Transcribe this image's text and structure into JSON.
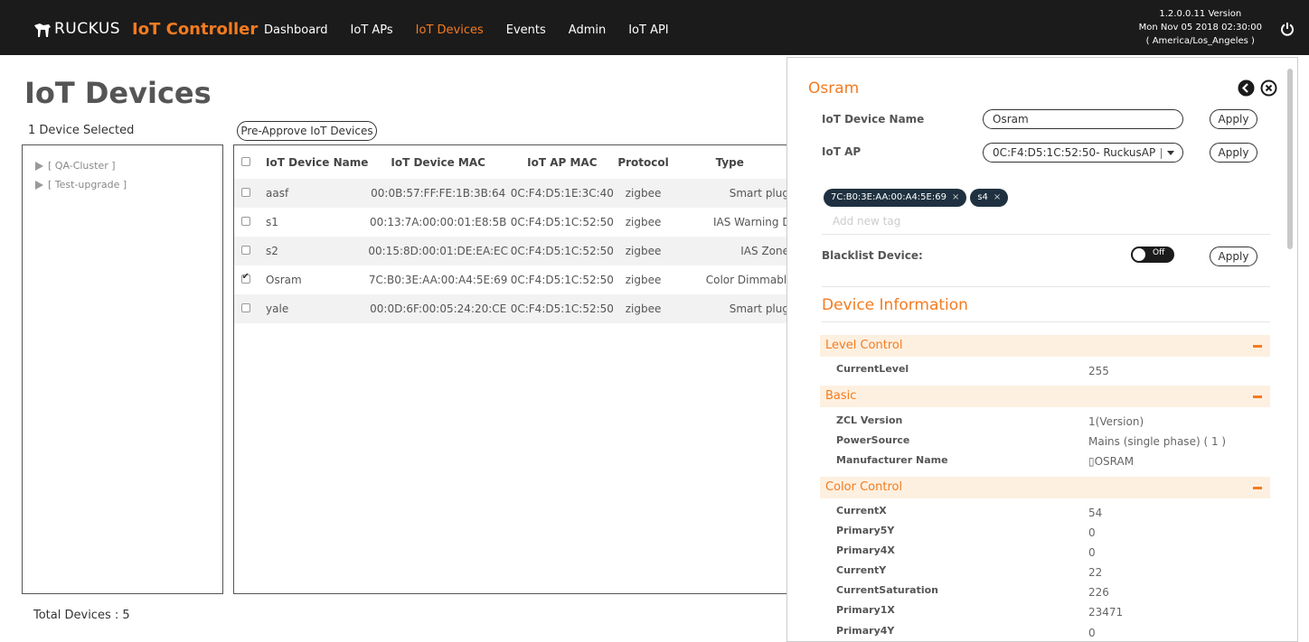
{
  "header": {
    "logo_text": "RUCKUS",
    "product": "IoT Controller",
    "nav": [
      "Dashboard",
      "IoT APs",
      "IoT Devices",
      "Events",
      "Admin",
      "IoT API"
    ],
    "version": "1.2.0.0.11 Version",
    "datetime": "Mon Nov 05 2018 02:30:00",
    "timezone": "( America/Los_Angeles )"
  },
  "page": {
    "title": "IoT Devices",
    "selected": "1 Device Selected",
    "preapprove": "Pre-Approve IoT Devices",
    "total": "Total Devices : 5"
  },
  "tree": [
    "[ QA-Cluster ]",
    "[ Test-upgrade ]"
  ],
  "table": {
    "headers": [
      "IoT Device Name",
      "IoT Device MAC",
      "IoT AP MAC",
      "Protocol",
      "Type"
    ],
    "rows": [
      {
        "name": "aasf",
        "mac": "00:0B:57:FF:FE:1B:3B:64",
        "apmac": "0C:F4:D5:1E:3C:40",
        "protocol": "zigbee",
        "type": "Smart plug"
      },
      {
        "name": "s1",
        "mac": "00:13:7A:00:00:01:E8:5B",
        "apmac": "0C:F4:D5:1C:52:50",
        "protocol": "zigbee",
        "type": "IAS Warning Devic"
      },
      {
        "name": "s2",
        "mac": "00:15:8D:00:01:DE:EA:EC",
        "apmac": "0C:F4:D5:1C:52:50",
        "protocol": "zigbee",
        "type": "IAS Zone"
      },
      {
        "name": "Osram",
        "mac": "7C:B0:3E:AA:00:A4:5E:69",
        "apmac": "0C:F4:D5:1C:52:50",
        "protocol": "zigbee",
        "type": "Color Dimmable Lig"
      },
      {
        "name": "yale",
        "mac": "00:0D:6F:00:05:24:20:CE",
        "apmac": "0C:F4:D5:1C:52:50",
        "protocol": "zigbee",
        "type": "Smart plug"
      }
    ]
  },
  "panel": {
    "title": "Osram",
    "device_name_label": "IoT Device Name",
    "device_name_value": "Osram",
    "ap_label": "IoT AP",
    "ap_value": "0C:F4:D5:1C:52:50- RuckusAP",
    "apply": "Apply",
    "tags": [
      "7C:B0:3E:AA:00:A4:5E:69",
      "s4"
    ],
    "tag_remove": "×",
    "add_tag_placeholder": "Add new tag",
    "blacklist_label": "Blacklist Device:",
    "toggle_text": "Off",
    "device_info_title": "Device Information",
    "groups": [
      {
        "title": "Level Control",
        "attrs": [
          {
            "k": "CurrentLevel",
            "v": "255"
          }
        ]
      },
      {
        "title": "Basic",
        "attrs": [
          {
            "k": "ZCL Version",
            "v": "1(Version)"
          },
          {
            "k": "PowerSource",
            "v": "Mains (single phase) ( 1 )"
          },
          {
            "k": "Manufacturer Name",
            "v": "▯OSRAM"
          }
        ]
      },
      {
        "title": "Color Control",
        "attrs": [
          {
            "k": "CurrentX",
            "v": "54"
          },
          {
            "k": "Primary5Y",
            "v": "0"
          },
          {
            "k": "Primary4X",
            "v": "0"
          },
          {
            "k": "CurrentY",
            "v": "22"
          },
          {
            "k": "CurrentSaturation",
            "v": "226"
          },
          {
            "k": "Primary1X",
            "v": "23471"
          },
          {
            "k": "Primary4Y",
            "v": "0"
          }
        ]
      }
    ]
  }
}
